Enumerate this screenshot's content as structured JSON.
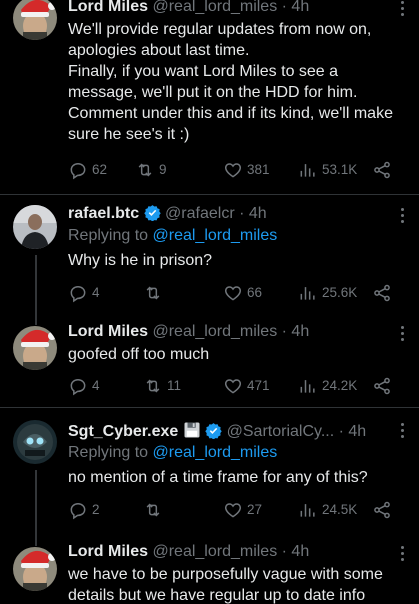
{
  "tweets": [
    {
      "name": "Lord Miles",
      "handle": "@real_lord_miles",
      "time": "· 4h",
      "body": "We'll provide regular updates from now on, apologies about last time.\nFinally, if you want Lord Miles to see a message, we'll put it on the HDD for him. Comment under this and if its kind, we'll make sure he see's it :)",
      "replies": "62",
      "retweets": "9",
      "likes": "381",
      "views": "53.1K"
    },
    {
      "name": "rafael.btc",
      "handle": "@rafaelcr",
      "time": "· 4h",
      "replying_prefix": "Replying to",
      "replying_to": "@real_lord_miles",
      "body": "Why is he in prison?",
      "replies": "4",
      "retweets": "",
      "likes": "66",
      "views": "25.6K"
    },
    {
      "name": "Lord Miles",
      "handle": "@real_lord_miles",
      "time": "· 4h",
      "body": "goofed off too much",
      "replies": "4",
      "retweets": "11",
      "likes": "471",
      "views": "24.2K"
    },
    {
      "name": "Sgt_Cyber.exe",
      "handle": "@SartorialCy...",
      "time": "· 4h",
      "replying_prefix": "Replying to",
      "replying_to": "@real_lord_miles",
      "body": "no mention of a time frame for any of this?",
      "replies": "2",
      "retweets": "",
      "likes": "27",
      "views": "24.5K"
    },
    {
      "name": "Lord Miles",
      "handle": "@real_lord_miles",
      "time": "· 4h",
      "body": "we have to be purposefully vague with some details but we have regular up to date info"
    }
  ],
  "colors": {
    "background": "#000000",
    "text": "#e7e9ea",
    "muted": "#71767b",
    "link": "#1d9bf0",
    "divider": "#2f3336"
  },
  "icons": {
    "reply": "reply-icon",
    "retweet": "retweet-icon",
    "like": "heart-icon",
    "views": "views-icon",
    "share": "share-icon",
    "verified": "verified-badge-icon",
    "floppy": "floppy-disk-emoji"
  }
}
